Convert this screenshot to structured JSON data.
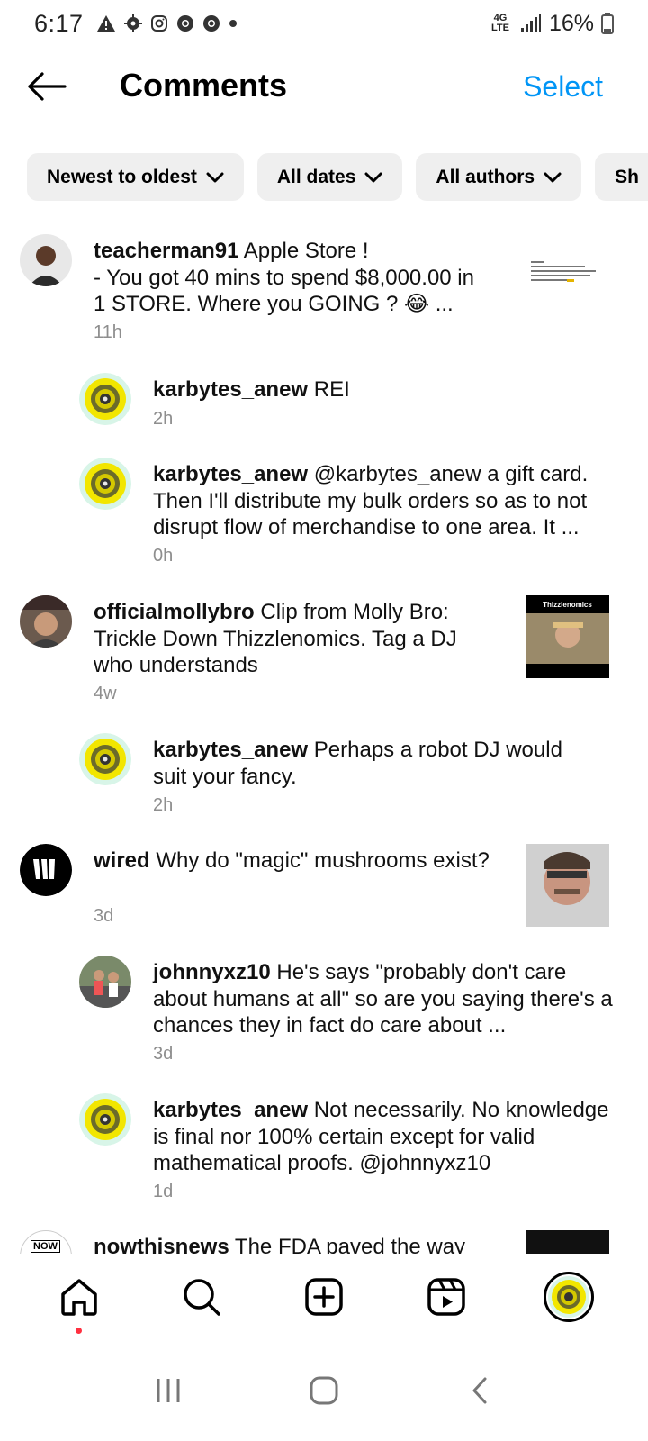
{
  "status": {
    "time": "6:17",
    "network": "4G LTE",
    "battery": "16%"
  },
  "header": {
    "title": "Comments",
    "select_label": "Select",
    "back_icon": "arrow-left-icon"
  },
  "filters": [
    {
      "label": "Newest to oldest"
    },
    {
      "label": "All dates"
    },
    {
      "label": "All authors"
    },
    {
      "label": "Sh"
    }
  ],
  "comments": [
    {
      "user": "teacherman91",
      "text": " Apple Store !\n- You got 40 mins to spend $8,000.00 in 1 STORE. Where you GOING ? 😂 ...",
      "time": "11h",
      "reply": false,
      "has_thumb": true
    },
    {
      "user": "karbytes_anew",
      "text": " REI",
      "time": "2h",
      "reply": true
    },
    {
      "user": "karbytes_anew",
      "text": " @karbytes_anew a gift card. Then I'll distribute my bulk orders so as to not disrupt flow of merchandise to one area. It ...",
      "time": "0h",
      "reply": true
    },
    {
      "user": "officialmollybro",
      "text": " Clip from Molly Bro: Trickle Down Thizzlenomics.  Tag a DJ who understands",
      "time": "4w",
      "reply": false,
      "has_thumb": true,
      "thumb_caption": "Thizzlenomics"
    },
    {
      "user": "karbytes_anew",
      "text": " Perhaps a robot DJ would suit your fancy.",
      "time": "2h",
      "reply": true
    },
    {
      "user": "wired",
      "text": " Why do \"magic\" mushrooms exist?",
      "time": "3d",
      "reply": false,
      "has_thumb": true
    },
    {
      "user": "johnnyxz10",
      "text": " He's says \"probably don't care about humans at all\" so are you saying there's a chances they in fact do care about ...",
      "time": "3d",
      "reply": true
    },
    {
      "user": "karbytes_anew",
      "text": " Not necessarily. No knowledge is final nor 100% certain except for valid mathematical proofs. @johnnyxz10",
      "time": "1d",
      "reply": true
    },
    {
      "user": "nowthisnews",
      "text": " The FDA paved the way",
      "time": "",
      "reply": false,
      "has_thumb": true,
      "avatar_label": "NOW"
    }
  ],
  "nav": {
    "items": [
      "home-icon",
      "search-icon",
      "create-icon",
      "reels-icon",
      "profile-avatar"
    ]
  },
  "colors": {
    "accent": "#0095f6",
    "chip_bg": "#efefef",
    "timestamp": "#8e8e8e",
    "notification_dot": "#ff3040"
  }
}
